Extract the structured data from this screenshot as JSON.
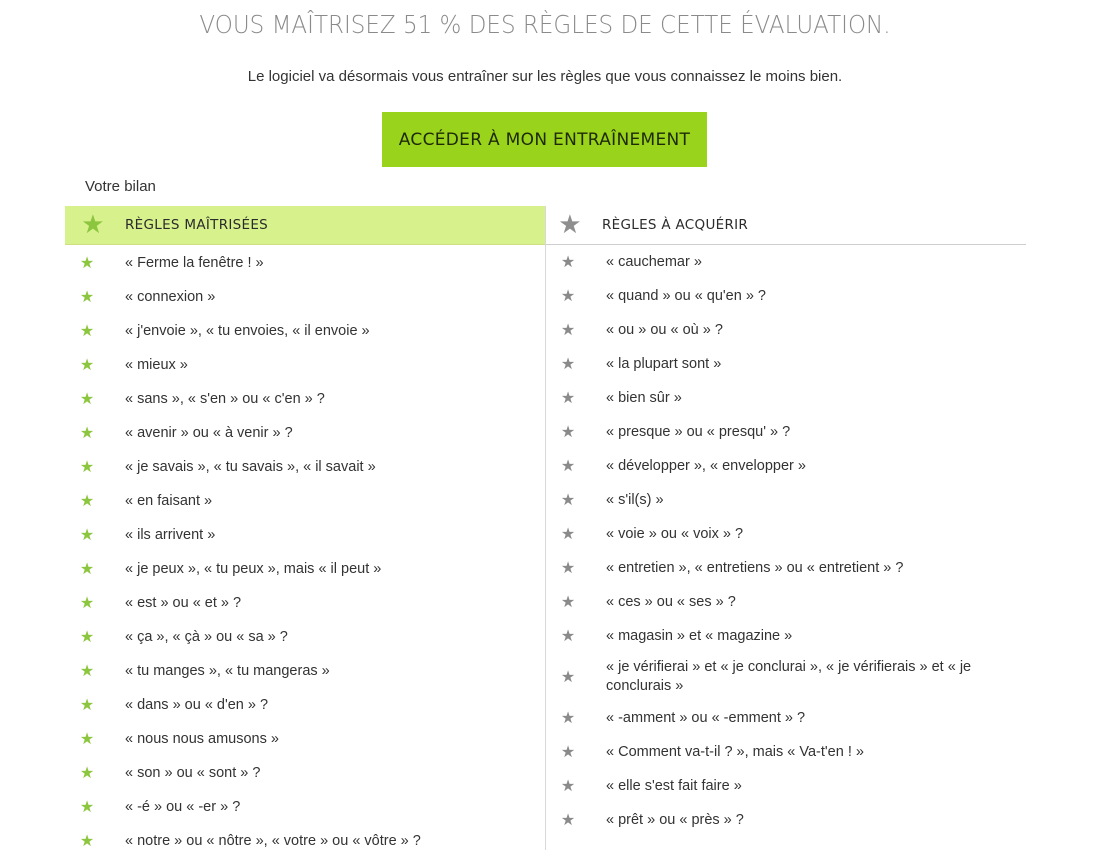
{
  "headline": "VOUS MAÎTRISEZ 51 % DES RÈGLES DE CETTE ÉVALUATION.",
  "subtitle": "Le logiciel va désormais vous entraîner sur les règles que vous connaissez le moins bien.",
  "cta_label": "ACCÉDER À MON ENTRAÎNEMENT",
  "bilan_label": "Votre bilan",
  "colors": {
    "accent": "#99d31c",
    "mastered_header_bg": "#d7f28c",
    "star_mastered": "#8cc63f",
    "star_to_learn": "#8a8a8a"
  },
  "mastered": {
    "title": "RÈGLES MAÎTRISÉES",
    "icon": "star-icon",
    "items": [
      "« Ferme la fenêtre ! »",
      "« connexion »",
      "« j'envoie », « tu envoies, « il envoie »",
      "« mieux »",
      "« sans », « s'en » ou « c'en » ?",
      "« avenir » ou « à venir » ?",
      "« je savais », « tu savais », « il savait »",
      "« en faisant »",
      "« ils arrivent »",
      "« je peux », « tu peux », mais « il peut »",
      "« est » ou « et » ?",
      "« ça », « çà » ou « sa » ?",
      "« tu manges », « tu mangeras »",
      "« dans » ou « d'en » ?",
      "« nous nous amusons »",
      "« son » ou « sont » ?",
      "« -é » ou « -er » ?",
      "« notre » ou « nôtre », « votre » ou « vôtre » ?"
    ]
  },
  "to_learn": {
    "title": "RÈGLES À ACQUÉRIR",
    "icon": "star-icon",
    "items": [
      "« cauchemar »",
      "« quand » ou « qu'en » ?",
      "« ou » ou « où » ?",
      "« la plupart sont »",
      "« bien sûr »",
      "« presque » ou « presqu' » ?",
      "« développer », « envelopper »",
      "« s'il(s) »",
      "« voie » ou « voix » ?",
      "« entretien », « entretiens » ou « entretient » ?",
      "« ces » ou « ses » ?",
      "« magasin » et « magazine »",
      "« je vérifierai » et « je conclurai », « je vérifierais » et « je conclurais »",
      "« -amment » ou « -emment » ?",
      "« Comment va-t-il ? », mais « Va-t'en ! »",
      "« elle s'est fait faire »",
      "« prêt » ou « près » ?"
    ]
  }
}
